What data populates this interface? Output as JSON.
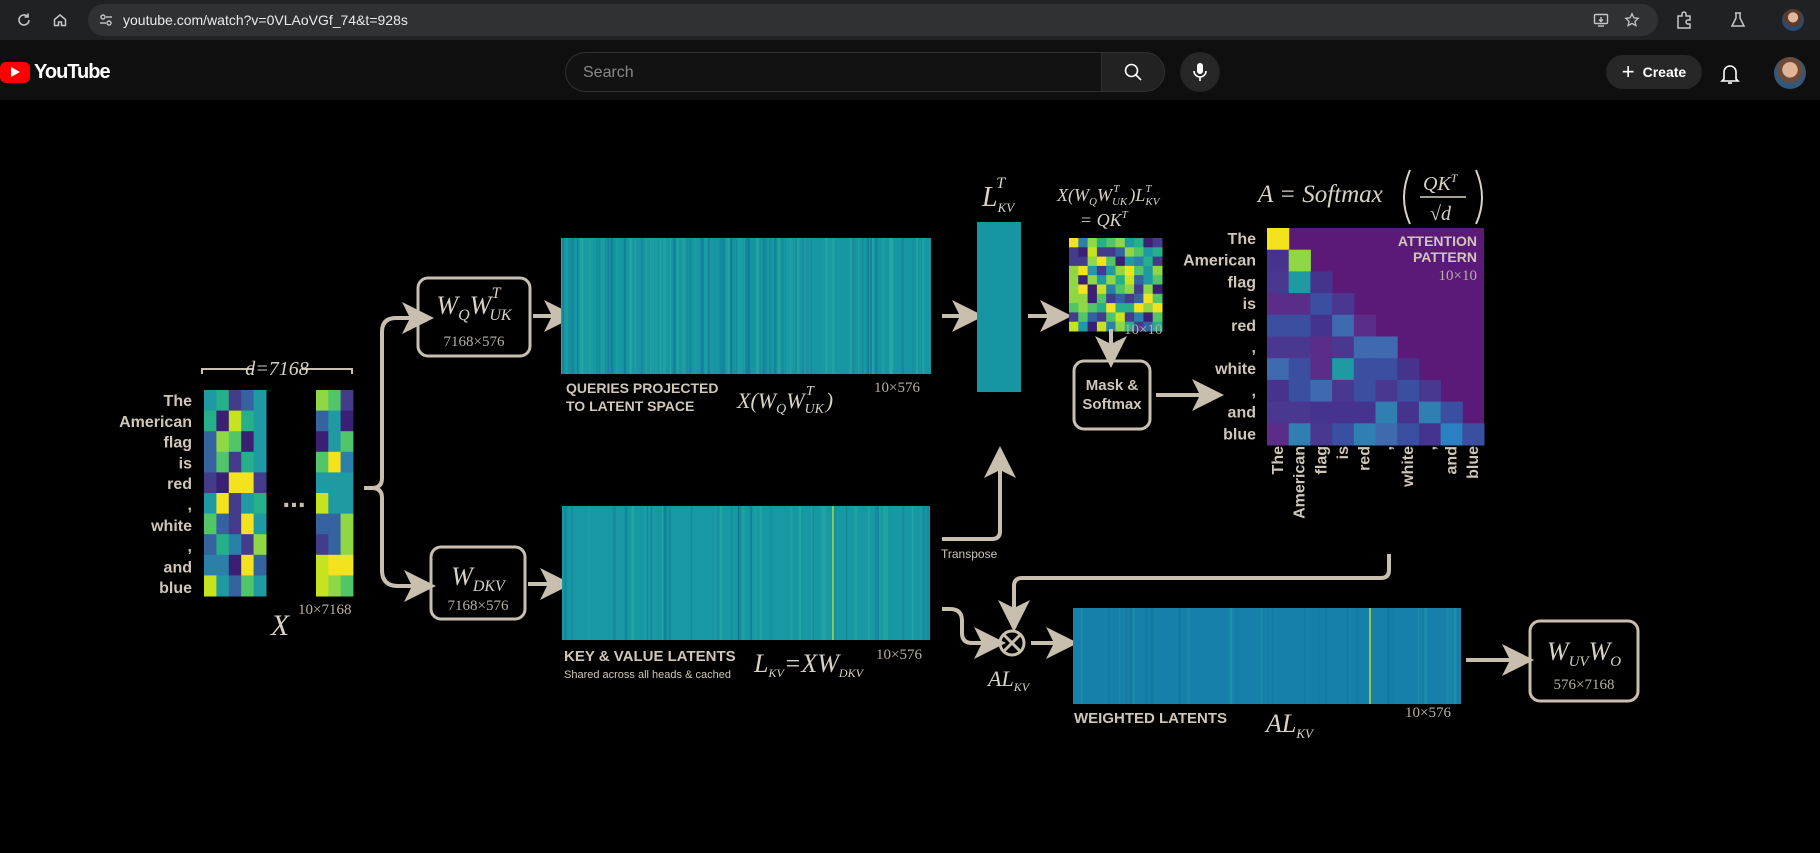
{
  "browser": {
    "url": "youtube.com/watch?v=0VLAoVGf_74&t=928s"
  },
  "header": {
    "logo_text": "YouTube",
    "search_placeholder": "Search",
    "create_label": "Create"
  },
  "video": {
    "tokens": [
      "The",
      "American",
      "flag",
      "is",
      "red",
      ",",
      "white",
      ",",
      "and",
      "blue"
    ],
    "x_dim_label": "d=7168",
    "x_symbol": "X",
    "x_size": "10×7168",
    "ellipsis": "...",
    "wq_box": {
      "formula": "W_Q W_UK^T",
      "size": "7168×576"
    },
    "wdkv_box": {
      "formula": "W_DKV",
      "size": "7168×576"
    },
    "queries": {
      "label_line1": "QUERIES PROJECTED",
      "label_line2": "TO LATENT SPACE",
      "formula": "X(W_Q W_UK^T)",
      "size": "10×576"
    },
    "kv": {
      "label": "KEY & VALUE LATENTS",
      "sublabel": "Shared across all heads & cached",
      "formula": "L_KV = XW_DKV",
      "size": "10×576"
    },
    "lkv_t_label": "L_KV^T",
    "transpose_label": "Transpose",
    "qk_formula_line1": "X(W_Q W_UK^T)L_KV^T",
    "qk_formula_line2": "= QK^T",
    "qk_size": "10×10",
    "mask_softmax_line1": "Mask &",
    "mask_softmax_line2": "Softmax",
    "attention_formula": "A = Softmax(QK^T / √d)",
    "attention_label_line1": "ATTENTION",
    "attention_label_line2": "PATTERN",
    "attention_size": "10×10",
    "al_kv_label": "AL_KV",
    "weighted": {
      "label": "WEIGHTED LATENTS",
      "formula": "AL_KV",
      "size": "10×576"
    },
    "wuv_box": {
      "formula": "W_UV W_O",
      "size": "576×7168"
    },
    "colors": {
      "teal": "#1a9aa0",
      "blue": "#1678a8",
      "purple": "#5c1a78",
      "yellow": "#f4e21f",
      "tan": "#c9bfae"
    }
  }
}
